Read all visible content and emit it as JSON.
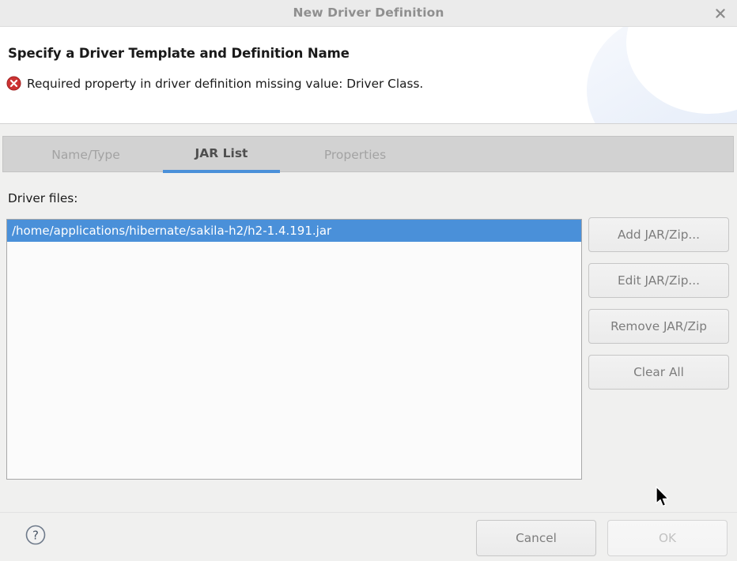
{
  "window": {
    "title": "New Driver Definition",
    "close_icon": "close-icon"
  },
  "header": {
    "title": "Specify a Driver Template and Definition Name",
    "error_icon": "error-icon",
    "message": "Required property in driver definition missing value: Driver Class.",
    "error_color": "#cc3333"
  },
  "tabs": [
    {
      "label": "Name/Type",
      "active": false
    },
    {
      "label": "JAR List",
      "active": true
    },
    {
      "label": "Properties",
      "active": false
    }
  ],
  "content": {
    "driver_files_label": "Driver files:",
    "files": [
      {
        "path": "/home/applications/hibernate/sakila-h2/h2-1.4.191.jar",
        "selected": true
      }
    ],
    "selection_color": "#4a90d9"
  },
  "side_buttons": [
    {
      "label": "Add JAR/Zip...",
      "enabled": true
    },
    {
      "label": "Edit JAR/Zip...",
      "enabled": true
    },
    {
      "label": "Remove JAR/Zip",
      "enabled": true
    },
    {
      "label": "Clear All",
      "enabled": true
    }
  ],
  "footer": {
    "help_icon": "help-question-icon",
    "cancel_label": "Cancel",
    "ok_label": "OK",
    "ok_enabled": false
  }
}
